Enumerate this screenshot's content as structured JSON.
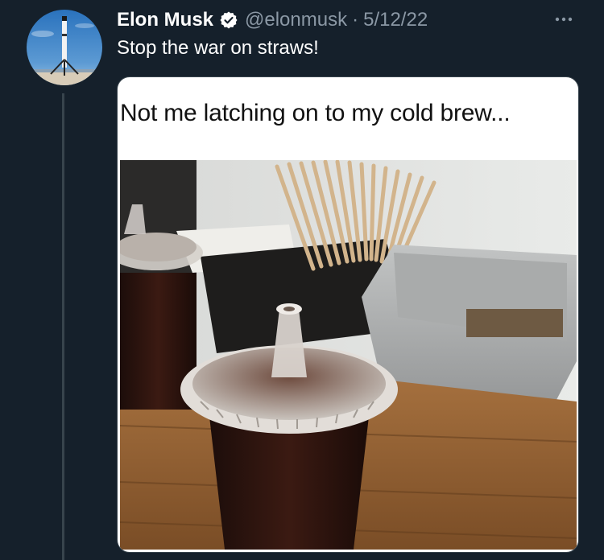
{
  "tweet": {
    "author_name": "Elon Musk",
    "handle": "@elonmusk",
    "separator": "·",
    "date": "5/12/22",
    "text": "Stop the war on straws!",
    "verified": true
  },
  "media": {
    "meme_caption": "Not me latching on to my cold brew..."
  },
  "icons": {
    "verified": "verified-badge-icon",
    "more": "more-options-icon"
  },
  "colors": {
    "background": "#15202b",
    "secondary_text": "#8b98a5",
    "thread_line": "#38444d",
    "primary_text": "#ffffff"
  }
}
